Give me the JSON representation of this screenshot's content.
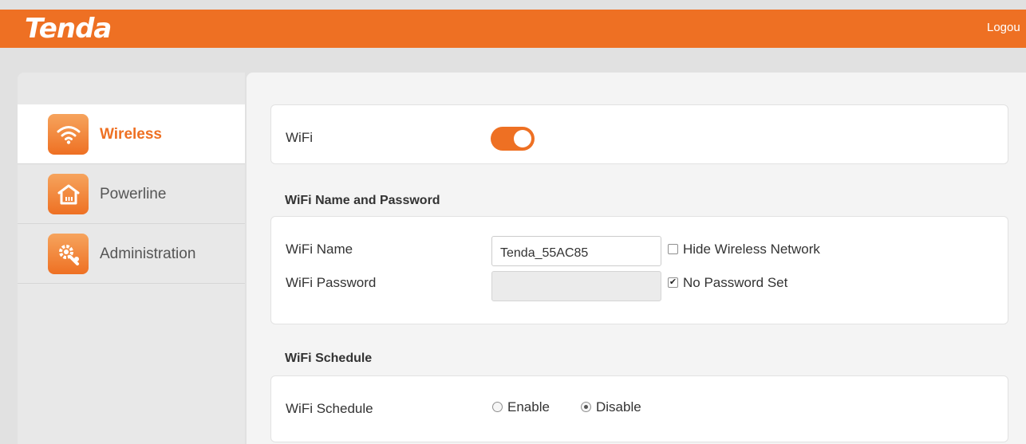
{
  "header": {
    "logo": "Tenda",
    "logout": "Logou",
    "accent_color": "#ee7023"
  },
  "sidebar": {
    "items": [
      {
        "label": "Wireless",
        "icon": "wifi-icon",
        "active": true
      },
      {
        "label": "Powerline",
        "icon": "home-icon",
        "active": false
      },
      {
        "label": "Administration",
        "icon": "gear-wrench-icon",
        "active": false
      }
    ]
  },
  "wifi": {
    "label": "WiFi",
    "enabled": true
  },
  "name_password": {
    "title": "WiFi Name and Password",
    "name_label": "WiFi Name",
    "name_value": "Tenda_55AC85",
    "hide_label": "Hide Wireless Network",
    "hide_checked": false,
    "password_label": "WiFi Password",
    "password_value": "",
    "no_password_label": "No Password Set",
    "no_password_checked": true
  },
  "schedule": {
    "title": "WiFi Schedule",
    "label": "WiFi Schedule",
    "options": [
      "Enable",
      "Disable"
    ],
    "selected": "Disable"
  }
}
